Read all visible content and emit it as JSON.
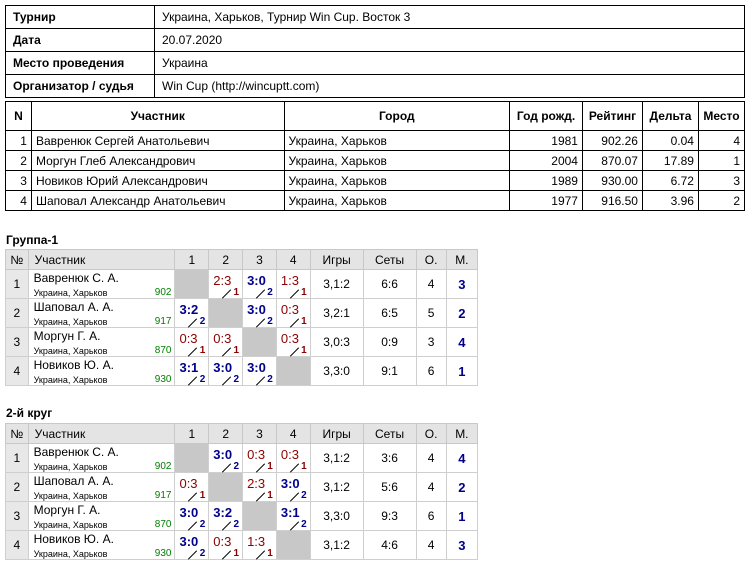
{
  "info": [
    {
      "k": "Турнир",
      "v": "Украина, Харьков, Турнир Win Cup. Восток 3"
    },
    {
      "k": "Дата",
      "v": "20.07.2020"
    },
    {
      "k": "Место проведения",
      "v": "Украина"
    },
    {
      "k": "Организатор / судья",
      "v": "Win Cup (http://wincuptt.com)"
    }
  ],
  "participants": {
    "headers": [
      "N",
      "Участник",
      "Город",
      "Год рожд.",
      "Рейтинг",
      "Дельта",
      "Место"
    ],
    "rows": [
      [
        "1",
        "Вавренюк Сергей Анатольевич",
        "Украина, Харьков",
        "1981",
        "902.26",
        "0.04",
        "4"
      ],
      [
        "2",
        "Моргун Глеб Александрович",
        "Украина, Харьков",
        "2004",
        "870.07",
        "17.89",
        "1"
      ],
      [
        "3",
        "Новиков Юрий Александрович",
        "Украина, Харьков",
        "1989",
        "930.00",
        "6.72",
        "3"
      ],
      [
        "4",
        "Шаповал Александр Анатольевич",
        "Украина, Харьков",
        "1977",
        "916.50",
        "3.96",
        "2"
      ]
    ]
  },
  "group_headers": [
    "№",
    "Участник",
    "1",
    "2",
    "3",
    "4",
    "Игры",
    "Сеты",
    "О.",
    "М."
  ],
  "groups": [
    {
      "title": "Группа-1",
      "rows": [
        {
          "n": "1",
          "name": "Вавренюк С. А.",
          "city": "Украина, Харьков",
          "rating": "902",
          "scores": [
            null,
            {
              "s": "2:3",
              "p": "1",
              "w": false
            },
            {
              "s": "3:0",
              "p": "2",
              "w": true
            },
            {
              "s": "1:3",
              "p": "1",
              "w": false
            }
          ],
          "games": "3,1:2",
          "sets": "6:6",
          "pts": "4",
          "place": "3"
        },
        {
          "n": "2",
          "name": "Шаповал А. А.",
          "city": "Украина, Харьков",
          "rating": "917",
          "scores": [
            {
              "s": "3:2",
              "p": "2",
              "w": true
            },
            null,
            {
              "s": "3:0",
              "p": "2",
              "w": true
            },
            {
              "s": "0:3",
              "p": "1",
              "w": false
            }
          ],
          "games": "3,2:1",
          "sets": "6:5",
          "pts": "5",
          "place": "2"
        },
        {
          "n": "3",
          "name": "Моргун Г. А.",
          "city": "Украина, Харьков",
          "rating": "870",
          "scores": [
            {
              "s": "0:3",
              "p": "1",
              "w": false
            },
            {
              "s": "0:3",
              "p": "1",
              "w": false
            },
            null,
            {
              "s": "0:3",
              "p": "1",
              "w": false
            }
          ],
          "games": "3,0:3",
          "sets": "0:9",
          "pts": "3",
          "place": "4"
        },
        {
          "n": "4",
          "name": "Новиков Ю. А.",
          "city": "Украина, Харьков",
          "rating": "930",
          "scores": [
            {
              "s": "3:1",
              "p": "2",
              "w": true
            },
            {
              "s": "3:0",
              "p": "2",
              "w": true
            },
            {
              "s": "3:0",
              "p": "2",
              "w": true
            },
            null
          ],
          "games": "3,3:0",
          "sets": "9:1",
          "pts": "6",
          "place": "1"
        }
      ]
    },
    {
      "title": "2-й круг",
      "rows": [
        {
          "n": "1",
          "name": "Вавренюк С. А.",
          "city": "Украина, Харьков",
          "rating": "902",
          "scores": [
            null,
            {
              "s": "3:0",
              "p": "2",
              "w": true
            },
            {
              "s": "0:3",
              "p": "1",
              "w": false
            },
            {
              "s": "0:3",
              "p": "1",
              "w": false
            }
          ],
          "games": "3,1:2",
          "sets": "3:6",
          "pts": "4",
          "place": "4"
        },
        {
          "n": "2",
          "name": "Шаповал А. А.",
          "city": "Украина, Харьков",
          "rating": "917",
          "scores": [
            {
              "s": "0:3",
              "p": "1",
              "w": false
            },
            null,
            {
              "s": "2:3",
              "p": "1",
              "w": false
            },
            {
              "s": "3:0",
              "p": "2",
              "w": true
            }
          ],
          "games": "3,1:2",
          "sets": "5:6",
          "pts": "4",
          "place": "2"
        },
        {
          "n": "3",
          "name": "Моргун Г. А.",
          "city": "Украина, Харьков",
          "rating": "870",
          "scores": [
            {
              "s": "3:0",
              "p": "2",
              "w": true
            },
            {
              "s": "3:2",
              "p": "2",
              "w": true
            },
            null,
            {
              "s": "3:1",
              "p": "2",
              "w": true
            }
          ],
          "games": "3,3:0",
          "sets": "9:3",
          "pts": "6",
          "place": "1"
        },
        {
          "n": "4",
          "name": "Новиков Ю. А.",
          "city": "Украина, Харьков",
          "rating": "930",
          "scores": [
            {
              "s": "3:0",
              "p": "2",
              "w": true
            },
            {
              "s": "0:3",
              "p": "1",
              "w": false
            },
            {
              "s": "1:3",
              "p": "1",
              "w": false
            },
            null
          ],
          "games": "3,1:2",
          "sets": "4:6",
          "pts": "4",
          "place": "3"
        }
      ]
    }
  ]
}
